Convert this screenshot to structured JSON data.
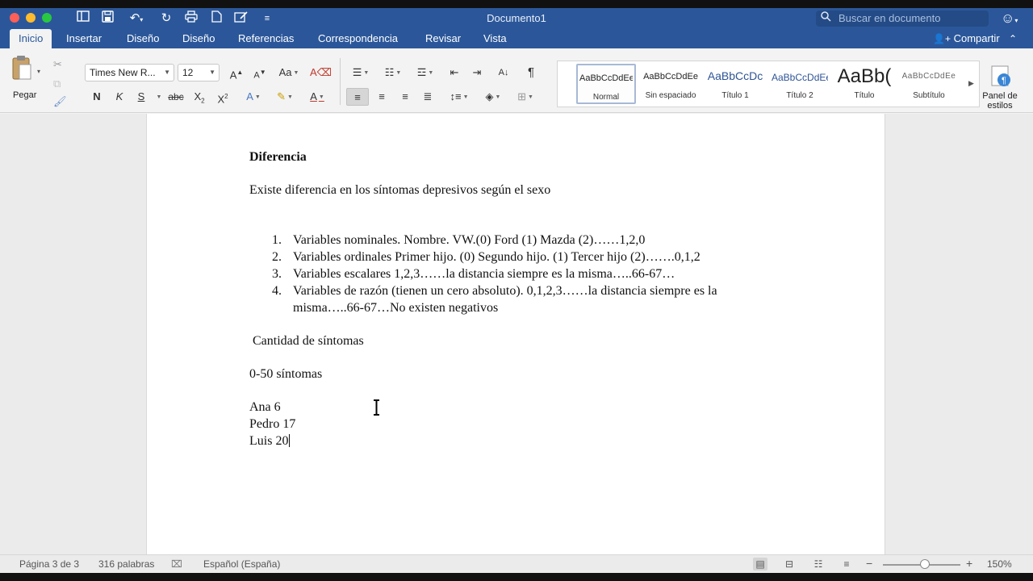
{
  "window": {
    "title": "Documento1"
  },
  "search": {
    "placeholder": "Buscar en documento"
  },
  "tabs": [
    {
      "label": "Inicio",
      "active": true
    },
    {
      "label": "Insertar"
    },
    {
      "label": "Diseño"
    },
    {
      "label": "Diseño"
    },
    {
      "label": "Referencias"
    },
    {
      "label": "Correspondencia"
    },
    {
      "label": "Revisar"
    },
    {
      "label": "Vista"
    }
  ],
  "share": {
    "label": "Compartir"
  },
  "ribbon": {
    "paste_label": "Pegar",
    "font_name": "Times New R...",
    "font_size": "12",
    "bold": "N",
    "italic": "K",
    "underline": "S",
    "strike": "abc",
    "pilcrow": "¶"
  },
  "styles": [
    {
      "sample": "AaBbCcDdEe",
      "name": "Normal",
      "selected": true
    },
    {
      "sample": "AaBbCcDdEe",
      "name": "Sin espaciado"
    },
    {
      "sample": "AaBbCcDc",
      "name": "Título 1"
    },
    {
      "sample": "AaBbCcDdEe",
      "name": "Título 2"
    },
    {
      "sample": "AaBb(",
      "name": "Título"
    },
    {
      "sample": "AaBbCcDdEe",
      "name": "Subtítulo"
    }
  ],
  "styles_pane": {
    "label": "Panel de estilos"
  },
  "document": {
    "heading": "Diferencia",
    "line1": "Existe diferencia en los síntomas depresivos según el sexo",
    "list": [
      {
        "num": "1.",
        "text": "Variables nominales. Nombre.   VW.(0)  Ford (1)   Mazda (2)……1,2,0"
      },
      {
        "num": "2.",
        "text": "Variables ordinales Primer hijo. (0)  Segundo hijo. (1)  Tercer hijo (2)…….0,1,2"
      },
      {
        "num": "3.",
        "text": "Variables escalares  1,2,3……la distancia siempre es la misma…..66-67…"
      },
      {
        "num": "4.",
        "text": "Variables de razón (tienen un cero absoluto). 0,1,2,3……la distancia siempre es la",
        "continuation": "misma…..66-67…No existen negativos"
      }
    ],
    "line_cantidad": " Cantidad de síntomas",
    "line_range": "0-50 síntomas",
    "people": [
      "Ana 6",
      "Pedro 17",
      "Luis 20"
    ]
  },
  "status": {
    "page": "Página 3 de 3",
    "words": "316 palabras",
    "language": "Español (España)",
    "zoom": "150%"
  },
  "colors": {
    "accent": "#2b579a"
  }
}
